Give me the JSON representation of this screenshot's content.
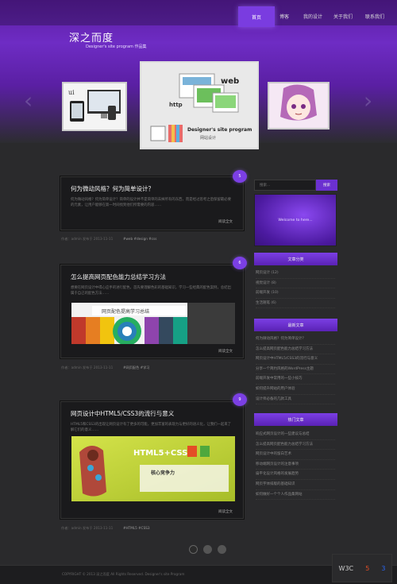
{
  "nav": {
    "items": [
      "首页",
      "博客",
      "我的设计",
      "关于我们",
      "联系我们"
    ]
  },
  "brand": {
    "logo": "深之而度",
    "tagline": "Designer's site program 作品集"
  },
  "carousel": {
    "left_caption": "ui",
    "center_caption": "Designer's site program",
    "center_sub": "网站设计",
    "center_web": "web",
    "center_http": "http"
  },
  "posts": [
    {
      "badge": "5",
      "title": "何为微动风格？何为简单设计？",
      "excerpt": "何为微动风格？何为简单设计？简单的设计并不是简单的去掉所有的东西，而是经过思考之后保留最必要的元素，让用户能够在第一时间找到他们所需要的内容……",
      "read_more": "阅读全文",
      "meta": "作者：admin 发布于 2013-11-11",
      "tags": "#web #design #css"
    },
    {
      "badge": "6",
      "title": "怎么提高网页配色能力总结学习方法",
      "excerpt": "想要在网页设计中得心应手的进行配色，首先要理解色彩的基础知识，学习一些经典的配色案例，总结出属于自己的配色方法……",
      "image_caption": "网页配色提高学习总结",
      "read_more": "阅读全文",
      "meta": "作者：admin 发布于 2013-11-11",
      "tags": "#网页配色 #学习"
    },
    {
      "badge": "9",
      "title": "网页设计中HTML5/CSS3的流行与意义",
      "excerpt": "HTML5和CSS3的出现让网页设计有了更多的可能，更加丰富的表现力与更好的语义化，让我们一起来了解它们的意义……",
      "image_caption": "HTML5+CSS3",
      "image_sub": "核心竞争力",
      "read_more": "阅读全文",
      "meta": "作者：admin 发布于 2013-11-11",
      "tags": "#HTML5 #CSS3"
    }
  ],
  "sidebar": {
    "search_placeholder": "搜索...",
    "search_button": "搜索",
    "welcome": "Welcome to here...",
    "categories_title": "文章分类",
    "categories": [
      "网页设计 (12)",
      "视觉设计 (8)",
      "前端开发 (10)",
      "生活随笔 (6)"
    ],
    "recent_title": "最新文章",
    "recent": [
      "何为微动风格？何为简单设计？",
      "怎么提高网页配色能力总结学习方法",
      "网页设计中HTML5/CSS3的流行与意义",
      "分享一个简约风格的WordPress主题",
      "前端开发中常用的一些小技巧",
      "如何提升网站的用户体验",
      "设计师必备的几款工具"
    ],
    "hot_title": "热门文章",
    "hot": [
      "响应式网页设计的一些建议与总结",
      "怎么提高网页配色能力总结学习方法",
      "网页设计中的留白艺术",
      "移动端网页设计的注意事项",
      "扁平化设计风格的发展趋势",
      "网页字体排版的基础知识",
      "如何做好一个个人作品集网站"
    ]
  },
  "footer": {
    "text": "COPYRIGHT © 2013 深之而度 All Rights Reserved. Designer's site Program"
  },
  "footer_badges": [
    "W3C",
    "5",
    "3"
  ],
  "colors": {
    "accent": "#7b3fe4",
    "background": "#2a2a2c",
    "card": "#1a1a1c"
  }
}
